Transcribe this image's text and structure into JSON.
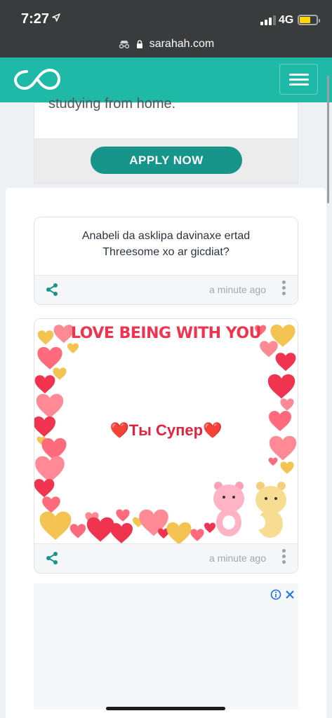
{
  "status_bar": {
    "time": "7:27",
    "network": "4G",
    "url": "sarahah.com"
  },
  "ad_top": {
    "text": "studying from home.",
    "button_label": "APPLY NOW"
  },
  "messages": [
    {
      "text": "Anabeli da asklipa davinaxe ertad Threesome xo ar gicdiat?",
      "time_ago": "a minute ago"
    },
    {
      "image_title": "LOVE BEING WITH YOU",
      "image_text": "❤️Ты Супер❤️",
      "time_ago": "a minute ago"
    }
  ],
  "colors": {
    "brand": "#1ebaa7",
    "button": "#17958b",
    "heart_red": "#f0344f"
  },
  "icons": [
    "location-arrow-icon",
    "signal-icon",
    "battery-icon",
    "incognito-icon",
    "lock-icon",
    "infinity-logo-icon",
    "hamburger-menu-icon",
    "share-icon",
    "more-vertical-icon",
    "ad-info-icon",
    "ad-close-icon"
  ]
}
